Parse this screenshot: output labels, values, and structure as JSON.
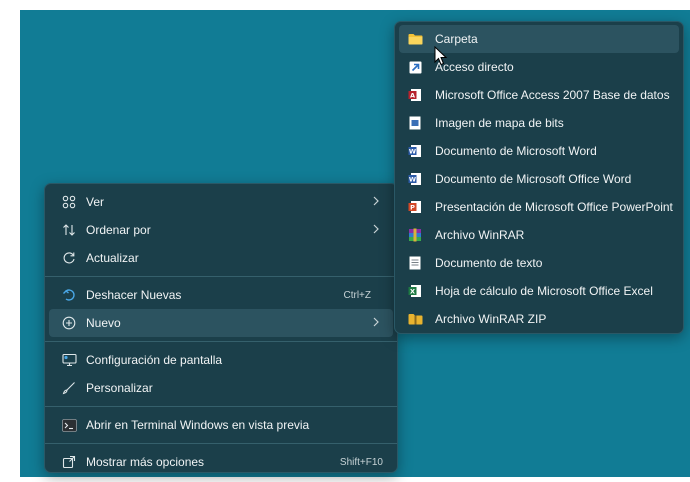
{
  "context_menu": {
    "items": [
      {
        "label": "Ver",
        "icon": "grid-view-icon",
        "has_submenu": true
      },
      {
        "label": "Ordenar por",
        "icon": "sort-arrows-icon",
        "has_submenu": true
      },
      {
        "label": "Actualizar",
        "icon": "refresh-icon",
        "has_submenu": false
      },
      {
        "label": "Deshacer Nuevas",
        "icon": "undo-icon",
        "shortcut": "Ctrl+Z"
      },
      {
        "label": "Nuevo",
        "icon": "new-plus-icon",
        "has_submenu": true
      },
      {
        "label": "Configuración de pantalla",
        "icon": "display-settings-icon"
      },
      {
        "label": "Personalizar",
        "icon": "brush-icon"
      },
      {
        "label": "Abrir en Terminal Windows en vista previa",
        "icon": "terminal-icon"
      },
      {
        "label": "Mostrar más opciones",
        "icon": "more-options-icon",
        "shortcut": "Shift+F10"
      }
    ]
  },
  "new_submenu": {
    "items": [
      {
        "label": "Carpeta",
        "icon": "folder-icon"
      },
      {
        "label": "Acceso directo",
        "icon": "shortcut-icon"
      },
      {
        "label": "Microsoft Office Access 2007 Base de datos",
        "icon": "access-database-icon"
      },
      {
        "label": "Imagen de mapa de bits",
        "icon": "bitmap-image-icon"
      },
      {
        "label": "Documento de Microsoft Word",
        "icon": "word-document-icon"
      },
      {
        "label": "Documento de Microsoft Office Word",
        "icon": "office-word-document-icon"
      },
      {
        "label": "Presentación de Microsoft Office PowerPoint",
        "icon": "powerpoint-icon"
      },
      {
        "label": "Archivo WinRAR",
        "icon": "winrar-archive-icon"
      },
      {
        "label": "Documento de texto",
        "icon": "text-document-icon"
      },
      {
        "label": "Hoja de cálculo de Microsoft Office Excel",
        "icon": "excel-icon"
      },
      {
        "label": "Archivo WinRAR ZIP",
        "icon": "winrar-zip-icon"
      }
    ]
  },
  "colors": {
    "desktop": "#117c95",
    "menu_background": "#1b3f4a",
    "hover": "#2c5360"
  }
}
